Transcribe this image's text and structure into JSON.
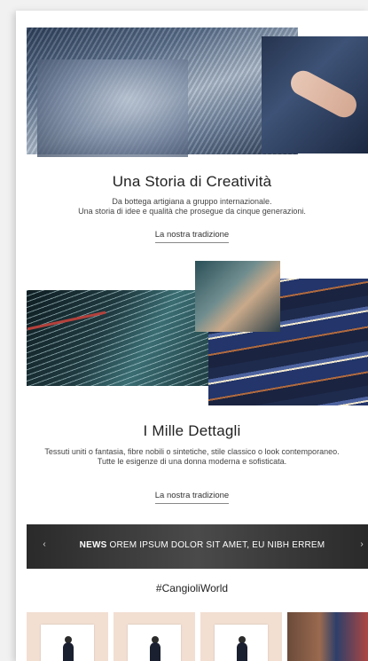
{
  "section_one": {
    "title": "Una Storia di Creatività",
    "description_line1": "Da bottega artigiana a gruppo internazionale.",
    "description_line2": "Una storia di idee e qualità che prosegue da cinque generazioni.",
    "link_label": "La nostra tradizione"
  },
  "section_two": {
    "title": "I Mille Dettagli",
    "description": "Tessuti uniti o fantasia, fibre nobili o sintetiche, stile classico o look contemporaneo. Tutte le esigenze di una donna moderna e sofisticata.",
    "link_label": "La nostra tradizione"
  },
  "news": {
    "label": "NEWS",
    "text": "OREM IPSUM DOLOR SIT AMET, EU NIBH ERREM",
    "prev_icon": "‹",
    "next_icon": "›"
  },
  "social": {
    "hashtag": "#CangioliWorld"
  },
  "icons": {
    "prev": "chevron-left-icon",
    "next": "chevron-right-icon"
  },
  "colors": {
    "news_bar": "#3a3a3a",
    "thumb_bg": "#f2dfd2"
  }
}
